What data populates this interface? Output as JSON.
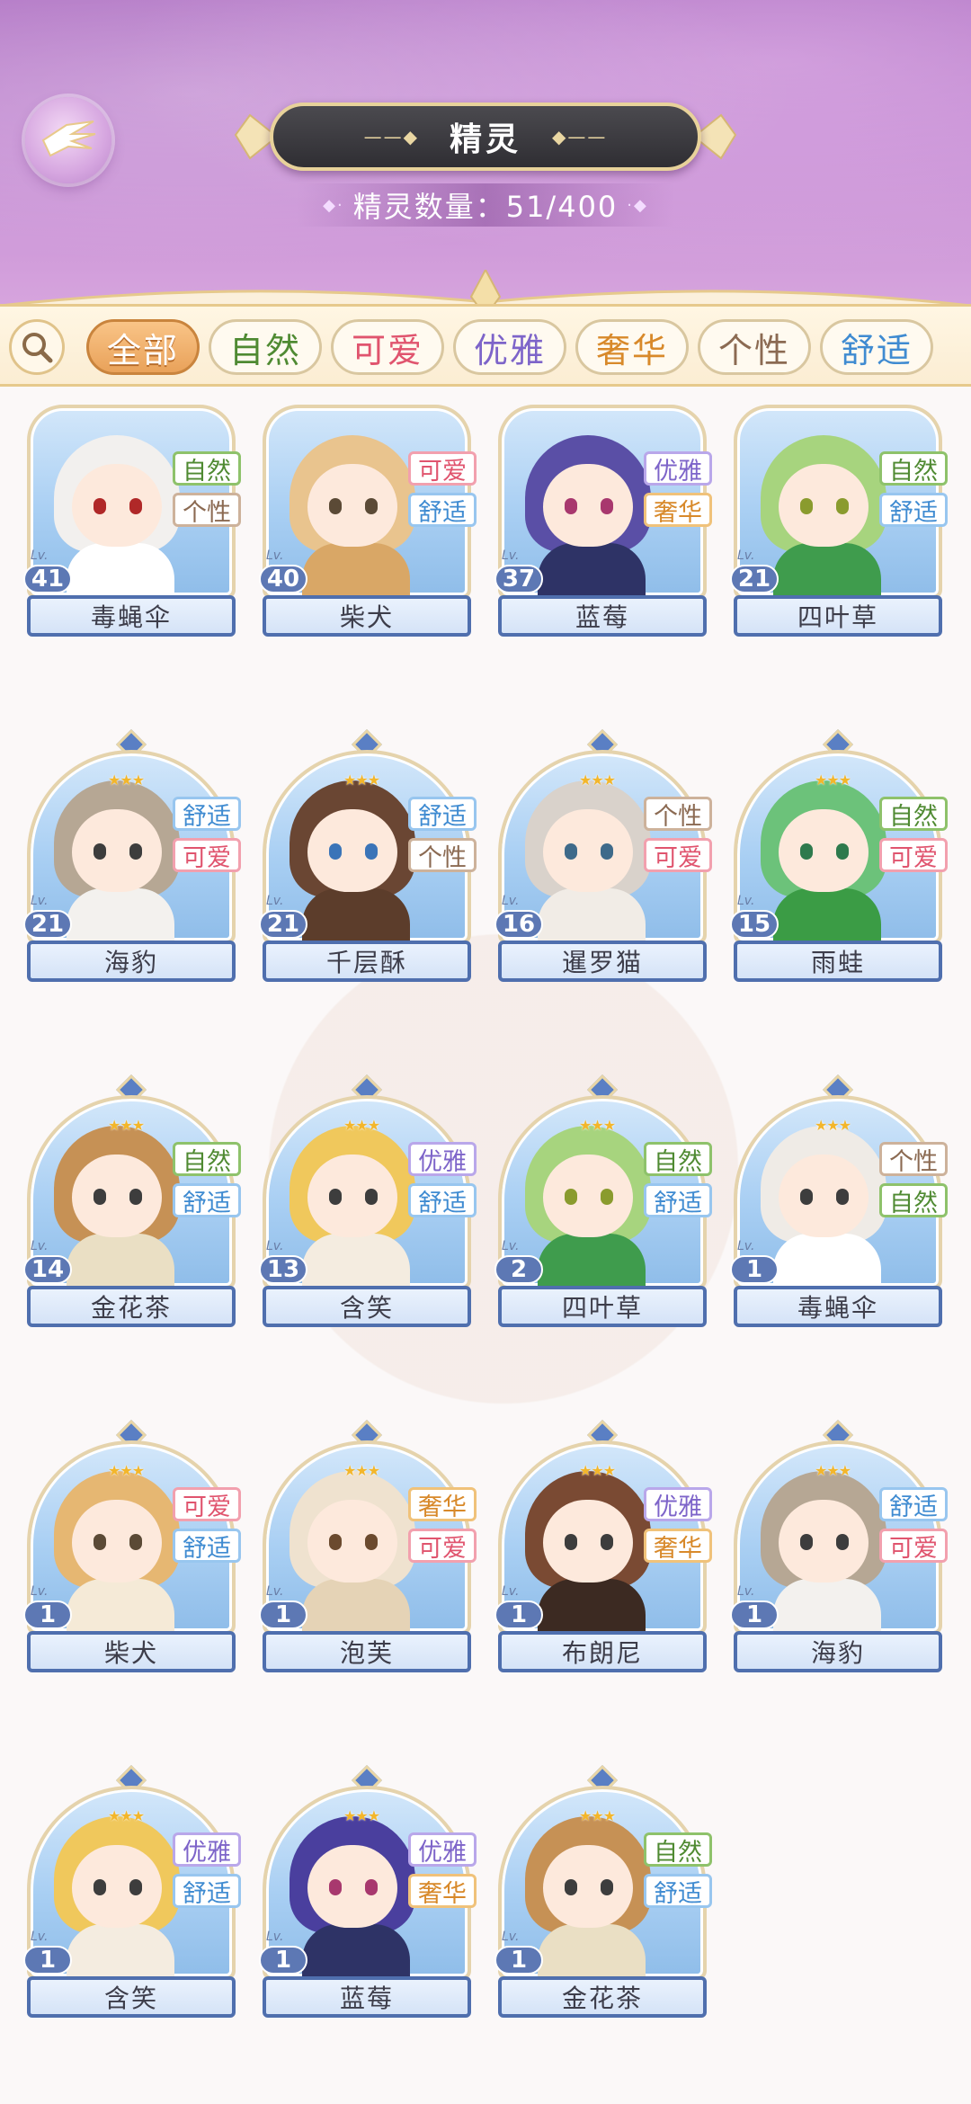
{
  "header": {
    "title": "精灵",
    "count_label": "精灵数量：51/400"
  },
  "filters": [
    {
      "label": "全部",
      "key": "all",
      "active": true,
      "color": "#e9a25a"
    },
    {
      "label": "自然",
      "key": "natural",
      "active": false,
      "color": "#4f8a32"
    },
    {
      "label": "可爱",
      "key": "cute",
      "active": false,
      "color": "#e0546e"
    },
    {
      "label": "优雅",
      "key": "elegant",
      "active": false,
      "color": "#7d64c9"
    },
    {
      "label": "奢华",
      "key": "luxury",
      "active": false,
      "color": "#d8892a"
    },
    {
      "label": "个性",
      "key": "personal",
      "active": false,
      "color": "#8b6a52"
    },
    {
      "label": "舒适",
      "key": "comfort",
      "active": false,
      "color": "#3f8bd1"
    }
  ],
  "tag_classes": {
    "自然": "natural",
    "可爱": "cute",
    "优雅": "elegant",
    "奢华": "luxury",
    "个性": "personal",
    "舒适": "comfort"
  },
  "level_prefix": "Lv.",
  "spirits": [
    {
      "name": "毒蝇伞",
      "level": "41",
      "tags": [
        "自然",
        "个性"
      ],
      "hair": "#f2f0ee",
      "outfit": "#ffffff",
      "eyes": "#b02828"
    },
    {
      "name": "柴犬",
      "level": "40",
      "tags": [
        "可爱",
        "舒适"
      ],
      "hair": "#e9c48e",
      "outfit": "#d9a766",
      "eyes": "#5b4a36"
    },
    {
      "name": "蓝莓",
      "level": "37",
      "tags": [
        "优雅",
        "奢华"
      ],
      "hair": "#5a4fa6",
      "outfit": "#2e3366",
      "eyes": "#a8386e"
    },
    {
      "name": "四叶草",
      "level": "21",
      "tags": [
        "自然",
        "舒适"
      ],
      "hair": "#a7d47e",
      "outfit": "#3f9c4d",
      "eyes": "#8a9b2e"
    },
    {
      "name": "海豹",
      "level": "21",
      "tags": [
        "舒适",
        "可爱"
      ],
      "hair": "#b6a794",
      "outfit": "#f3f1ee",
      "eyes": "#3d3d3d"
    },
    {
      "name": "千层酥",
      "level": "21",
      "tags": [
        "舒适",
        "个性"
      ],
      "hair": "#6a4633",
      "outfit": "#5c3d2b",
      "eyes": "#3a74b8"
    },
    {
      "name": "暹罗猫",
      "level": "16",
      "tags": [
        "个性",
        "可爱"
      ],
      "hair": "#d9d2cb",
      "outfit": "#f1ece6",
      "eyes": "#3e6a8a"
    },
    {
      "name": "雨蛙",
      "level": "15",
      "tags": [
        "自然",
        "可爱"
      ],
      "hair": "#6cc27a",
      "outfit": "#3b9c45",
      "eyes": "#2e7a4d"
    },
    {
      "name": "金花茶",
      "level": "14",
      "tags": [
        "自然",
        "舒适"
      ],
      "hair": "#c69155",
      "outfit": "#eadfc4",
      "eyes": "#3d3d3d"
    },
    {
      "name": "含笑",
      "level": "13",
      "tags": [
        "优雅",
        "舒适"
      ],
      "hair": "#f0c85c",
      "outfit": "#f4ece0",
      "eyes": "#3d3d3d"
    },
    {
      "name": "四叶草",
      "level": "2",
      "tags": [
        "自然",
        "舒适"
      ],
      "hair": "#a7d47e",
      "outfit": "#3f9c4d",
      "eyes": "#8a9b2e"
    },
    {
      "name": "毒蝇伞",
      "level": "1",
      "tags": [
        "个性",
        "自然"
      ],
      "hair": "#efebe6",
      "outfit": "#ffffff",
      "eyes": "#3d3d3d"
    },
    {
      "name": "柴犬",
      "level": "1",
      "tags": [
        "可爱",
        "舒适"
      ],
      "hair": "#e6b772",
      "outfit": "#f5ead7",
      "eyes": "#5b4a36"
    },
    {
      "name": "泡芙",
      "level": "1",
      "tags": [
        "奢华",
        "可爱"
      ],
      "hair": "#efe2cf",
      "outfit": "#e5d3b6",
      "eyes": "#6b4a2e"
    },
    {
      "name": "布朗尼",
      "level": "1",
      "tags": [
        "优雅",
        "奢华"
      ],
      "hair": "#7a4a33",
      "outfit": "#3c2a22",
      "eyes": "#3d3d3d"
    },
    {
      "name": "海豹",
      "level": "1",
      "tags": [
        "舒适",
        "可爱"
      ],
      "hair": "#b6a794",
      "outfit": "#f3f1ee",
      "eyes": "#3d3d3d"
    },
    {
      "name": "含笑",
      "level": "1",
      "tags": [
        "优雅",
        "舒适"
      ],
      "hair": "#f0c85c",
      "outfit": "#f4ece0",
      "eyes": "#3d3d3d"
    },
    {
      "name": "蓝莓",
      "level": "1",
      "tags": [
        "优雅",
        "奢华"
      ],
      "hair": "#4a3f9e",
      "outfit": "#2e3366",
      "eyes": "#a8386e"
    },
    {
      "name": "金花茶",
      "level": "1",
      "tags": [
        "自然",
        "舒适"
      ],
      "hair": "#c69155",
      "outfit": "#eadfc4",
      "eyes": "#3d3d3d"
    }
  ]
}
